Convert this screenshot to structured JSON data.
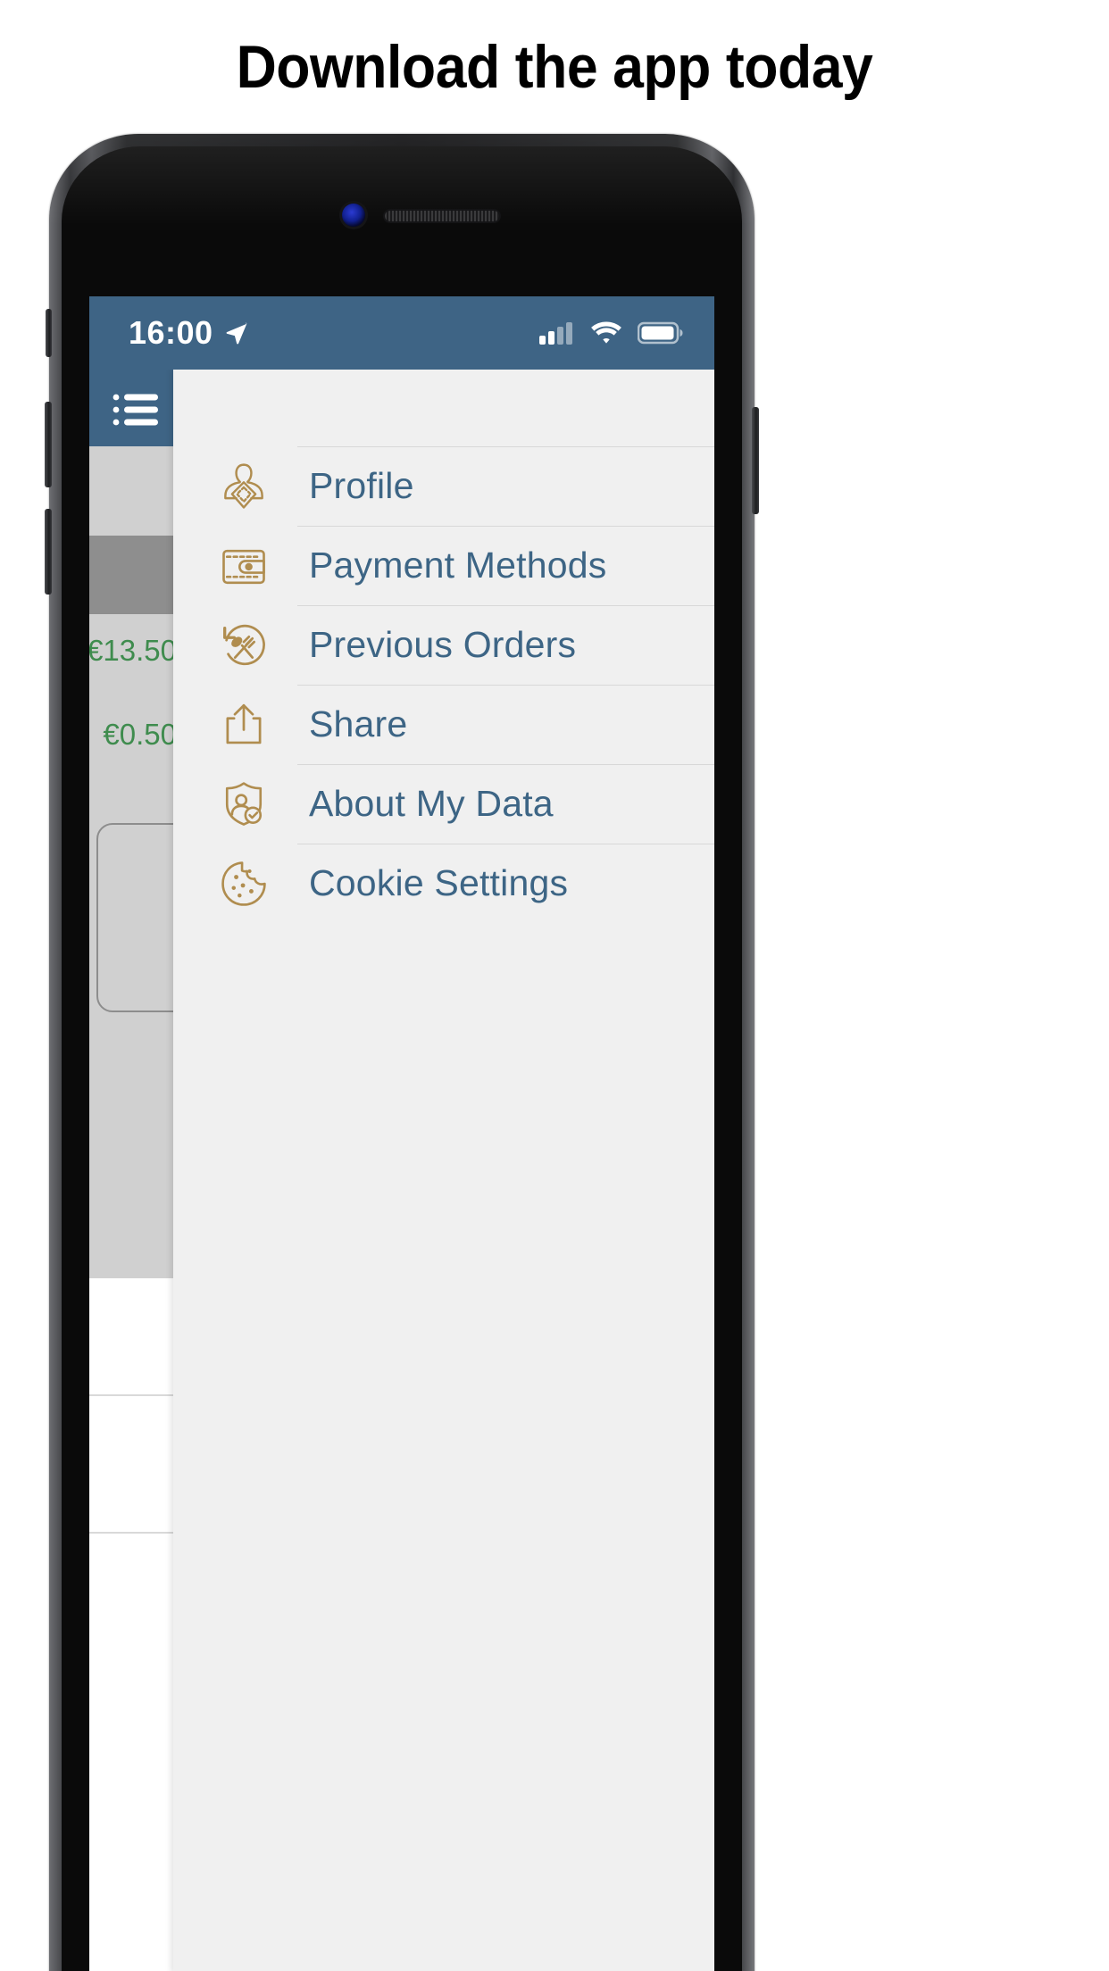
{
  "headline": "Download the app today",
  "status_bar": {
    "time": "16:00",
    "location_icon": "location-arrow-icon",
    "signal_icon": "cellular-signal-icon",
    "signal_bars_filled": 2,
    "signal_bars_total": 4,
    "wifi_icon": "wifi-icon",
    "battery_icon": "battery-icon",
    "battery_level_pct": 85,
    "background_color": "#3e6485",
    "foreground_color": "#ffffff"
  },
  "nav": {
    "menu_button_icon": "hamburger-list-icon",
    "menu_button_label": "Menu"
  },
  "drawer": {
    "background_color": "#f0f0f0",
    "label_color": "#3d6585",
    "icon_color": "#b08d4f",
    "items": [
      {
        "label": "Profile",
        "icon": "profile-person-icon"
      },
      {
        "label": "Payment Methods",
        "icon": "wallet-icon"
      },
      {
        "label": "Previous Orders",
        "icon": "cutlery-refresh-icon"
      },
      {
        "label": "Share",
        "icon": "share-upload-icon"
      },
      {
        "label": "About My Data",
        "icon": "shield-person-check-icon"
      },
      {
        "label": "Cookie Settings",
        "icon": "cookie-icon"
      }
    ]
  },
  "background_app": {
    "price_1": "€13.50",
    "price_2": "€0.50",
    "price_color": "#3f8c4e",
    "row_color": "#d0d0d0",
    "row_highlight_color": "#8e8e8e"
  }
}
